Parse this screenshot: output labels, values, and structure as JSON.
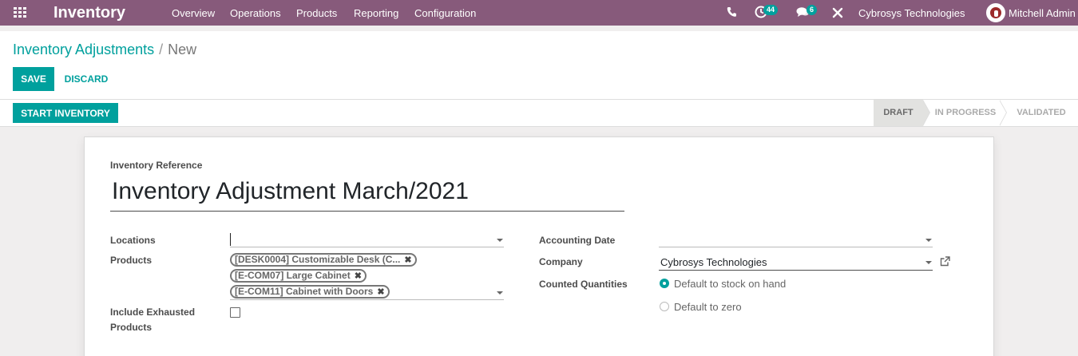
{
  "navbar": {
    "app_name": "Inventory",
    "menu": [
      "Overview",
      "Operations",
      "Products",
      "Reporting",
      "Configuration"
    ],
    "activity_count": "44",
    "message_count": "6",
    "company": "Cybrosys Technologies",
    "user": "Mitchell Admin"
  },
  "breadcrumb": {
    "parent": "Inventory Adjustments",
    "separator": "/",
    "current": "New"
  },
  "buttons": {
    "save": "SAVE",
    "discard": "DISCARD",
    "start_inventory": "START INVENTORY"
  },
  "statusbar": {
    "stages": [
      "DRAFT",
      "IN PROGRESS",
      "VALIDATED"
    ],
    "active": "DRAFT"
  },
  "form": {
    "reference_label": "Inventory Reference",
    "reference_value": "Inventory Adjustment March/2021",
    "locations_label": "Locations",
    "locations_value": "",
    "products_label": "Products",
    "products": [
      "[DESK0004] Customizable Desk (C...",
      "[E-COM07] Large Cabinet",
      "[E-COM11] Cabinet with Doors"
    ],
    "exhausted_label_line1": "Include Exhausted",
    "exhausted_label_line2": "Products",
    "exhausted_checked": false,
    "accounting_date_label": "Accounting Date",
    "accounting_date_value": "",
    "company_label": "Company",
    "company_value": "Cybrosys Technologies",
    "counted_label": "Counted Quantities",
    "counted_options": [
      "Default to stock on hand",
      "Default to zero"
    ],
    "counted_selected": "Default to stock on hand"
  },
  "colors": {
    "navbar": "#875a7b",
    "accent": "#00a09d"
  }
}
